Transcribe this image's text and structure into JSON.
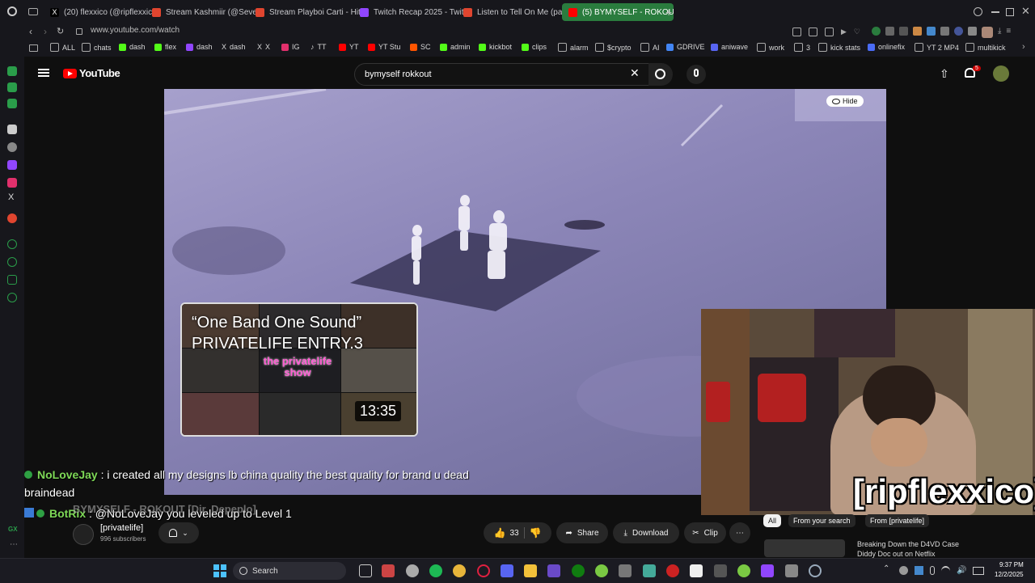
{
  "browser": {
    "tabs": [
      {
        "label": "(20) flexxico (@ripflexxico",
        "color": "#ffffff"
      },
      {
        "label": "Stream Kashmiir (@Sever",
        "color": "#e0452f"
      },
      {
        "label": "Stream Playboi Carti - Hit",
        "color": "#e0452f"
      },
      {
        "label": "Twitch Recap 2025 - Twit",
        "color": "#9146ff"
      },
      {
        "label": "Listen to Tell On Me (patr",
        "color": "#e0452f"
      },
      {
        "label": "(5) BYMYSELF - ROKOUT",
        "color": "#ff0000"
      }
    ],
    "url": "www.youtube.com/watch",
    "bookmarks": [
      "ALL",
      "chats",
      "dash",
      "flex",
      "dash",
      "dash",
      "X",
      "IG",
      "TT",
      "YT",
      "YT Stu",
      "SC",
      "admin",
      "kickbot",
      "clips",
      "alarm",
      "$crypto",
      "AI",
      "GDRIVE",
      "aniwave",
      "work",
      "3",
      "kick stats",
      "onlinefix",
      "YT 2 MP4",
      "multikick"
    ]
  },
  "youtube": {
    "logo_text": "YouTube",
    "search_value": "bymyself rokkout",
    "notif_count": "5",
    "hide_label": "Hide"
  },
  "thumb": {
    "title_line1": "“One Band One Sound”",
    "title_line2": "PRIVATELIFE ENTRY.3",
    "brand": "the privatelife show",
    "duration": "13:35"
  },
  "chat": [
    {
      "user": "NoLoveJay",
      "text": ": i created all my designs lb china quality the best quality for brand u dead braindead",
      "user_color": "#7ed957"
    },
    {
      "user": "BotRix",
      "text": ": @NoLoveJay you leveled up to Level 1",
      "user_color": "#7ed957"
    }
  ],
  "video_title_overlay": "BYMYSELF - ROKOUT [Dir. Depeplo]",
  "channel": {
    "name": "[privatelife]",
    "subs": "996 subscribers"
  },
  "actions": {
    "likes": "33",
    "share": "Share",
    "download": "Download",
    "clip": "Clip"
  },
  "filters": [
    "All",
    "From your search",
    "From [privatelife]"
  ],
  "rec": {
    "line1": "Breaking Down the D4VD Case",
    "line2": "Diddy Doc out on Netflix"
  },
  "streamer_name": "[ripflexxico]",
  "taskbar": {
    "search": "Search",
    "time": "9:37 PM",
    "date": "12/2/2025"
  },
  "sidebar_gx": "GX"
}
